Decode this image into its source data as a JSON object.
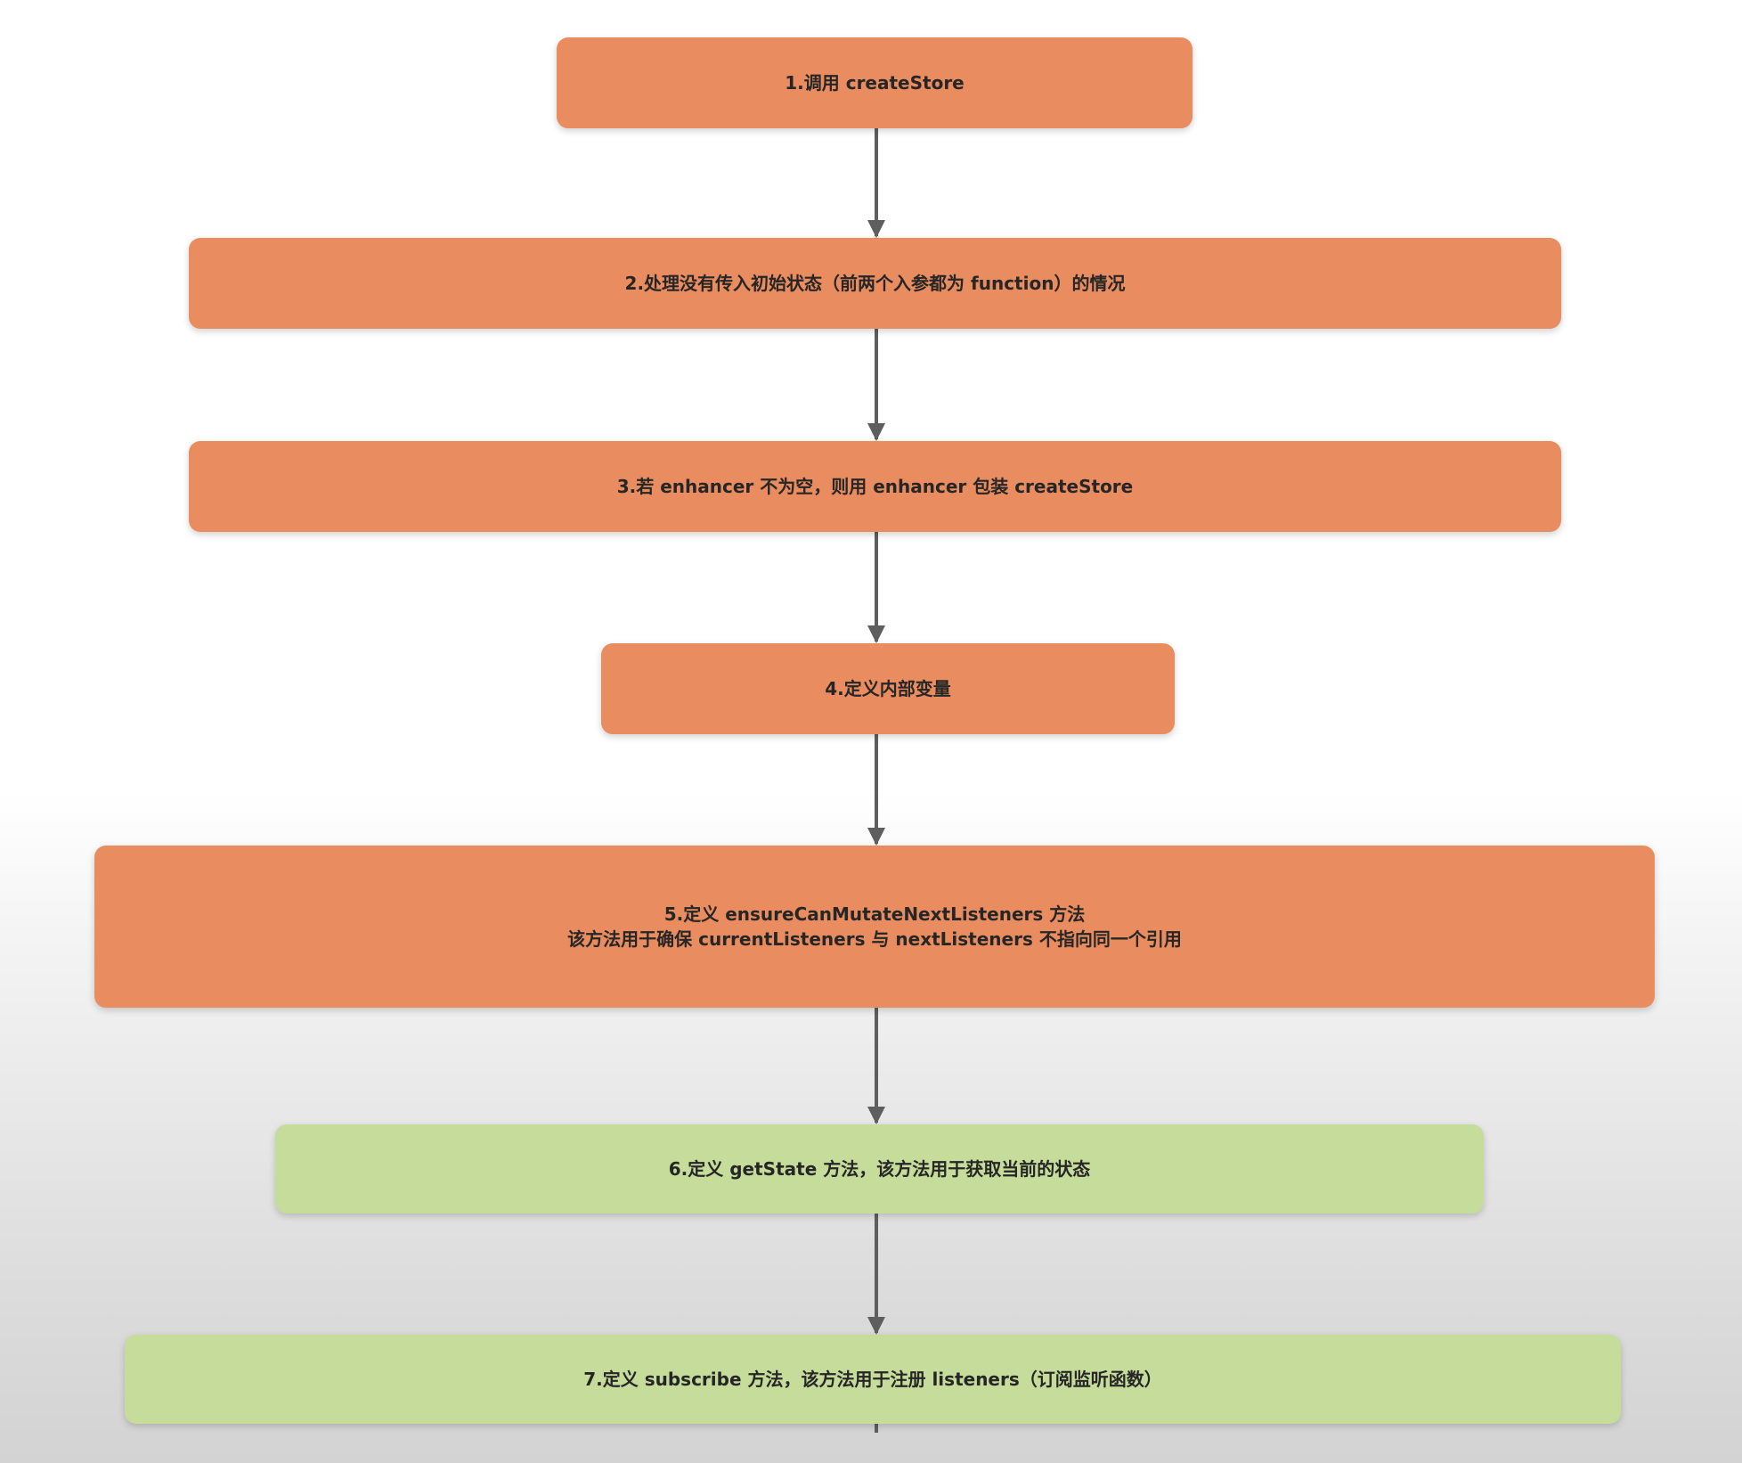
{
  "steps": [
    {
      "id": "step-1",
      "lines": [
        "1.调用 createStore"
      ],
      "color": "#e98c5f"
    },
    {
      "id": "step-2",
      "lines": [
        "2.处理没有传入初始状态（前两个入参都为 function）的情况"
      ],
      "color": "#e98c5f"
    },
    {
      "id": "step-3",
      "lines": [
        "3.若 enhancer 不为空，则用 enhancer 包装 createStore"
      ],
      "color": "#e98c5f"
    },
    {
      "id": "step-4",
      "lines": [
        "4.定义内部变量"
      ],
      "color": "#e98c5f"
    },
    {
      "id": "step-5",
      "lines": [
        "5.定义 ensureCanMutateNextListeners 方法",
        "该方法用于确保 currentListeners 与 nextListeners 不指向同一个引用"
      ],
      "color": "#e98c5f"
    },
    {
      "id": "step-6",
      "lines": [
        "6.定义 getState 方法，该方法用于获取当前的状态"
      ],
      "color": "#c5dc9a"
    },
    {
      "id": "step-7",
      "lines": [
        "7.定义 subscribe 方法，该方法用于注册 listeners（订阅监听函数）"
      ],
      "color": "#c5dc9a"
    }
  ],
  "colors": {
    "step_orange": "#e98c5f",
    "step_green": "#c5dc9a",
    "connector": "#5e5e5e",
    "text": "#262626"
  }
}
